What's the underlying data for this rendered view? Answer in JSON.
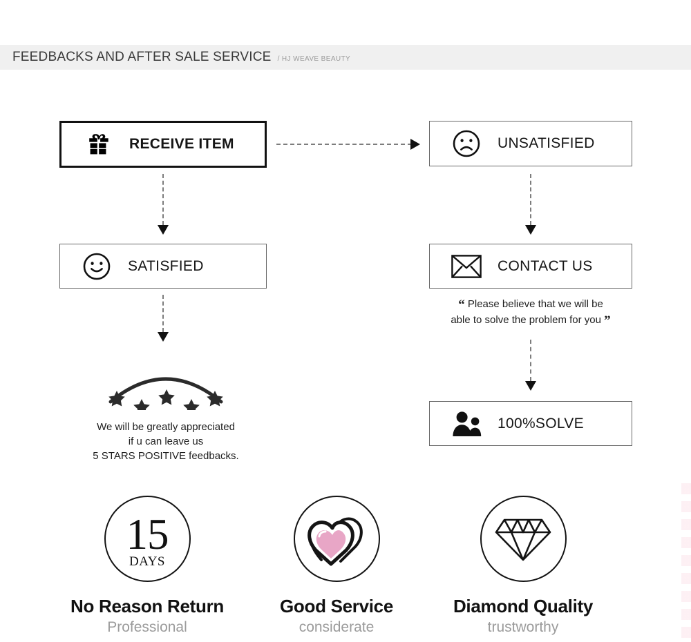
{
  "header": {
    "title": "FEEDBACKS AND AFTER SALE SERVICE",
    "subtitle": "/ HJ WEAVE BEAUTY",
    "band_color": "#f0f0f0"
  },
  "flow": {
    "boxes": [
      {
        "id": "receive",
        "label": "RECEIVE ITEM",
        "icon": "gift-icon",
        "emphasis": "thick"
      },
      {
        "id": "unsat",
        "label": "UNSATISFIED",
        "icon": "sad-face-icon",
        "emphasis": "thin"
      },
      {
        "id": "satisfied",
        "label": "SATISFIED",
        "icon": "smile-face-icon",
        "emphasis": "thin"
      },
      {
        "id": "contact",
        "label": "CONTACT US",
        "icon": "envelope-icon",
        "emphasis": "thin"
      },
      {
        "id": "solve",
        "label": "100%SOLVE",
        "icon": "two-people-icon",
        "emphasis": "thin"
      }
    ],
    "arrows": [
      {
        "id": "receive-to-unsat",
        "direction": "right",
        "style": "dashed"
      },
      {
        "id": "receive-to-satisfied",
        "direction": "down",
        "style": "dashed"
      },
      {
        "id": "unsat-to-contact",
        "direction": "down",
        "style": "dashed"
      },
      {
        "id": "satisfied-to-stars",
        "direction": "down",
        "style": "dashed"
      },
      {
        "id": "contact-to-solve",
        "direction": "down",
        "style": "dashed"
      }
    ]
  },
  "quote": {
    "open_mark": "“",
    "close_mark": "”",
    "line1": "Please believe that we will be",
    "line2": "able to solve the problem for you"
  },
  "feedback": {
    "star_count": 5,
    "line1": "We will be greatly appreciated",
    "line2": "if u can leave us",
    "line3": "5 STARS POSITIVE feedbacks."
  },
  "badges": [
    {
      "icon": "fifteen-days-icon",
      "number": "15",
      "unit": "DAYS",
      "title": "No Reason Return",
      "subtitle": "Professional"
    },
    {
      "icon": "heart-icon",
      "title": "Good Service",
      "subtitle": "considerate",
      "accent_color": "#e8a6c6"
    },
    {
      "icon": "diamond-icon",
      "title": "Diamond Quality",
      "subtitle": "trustworthy"
    }
  ]
}
